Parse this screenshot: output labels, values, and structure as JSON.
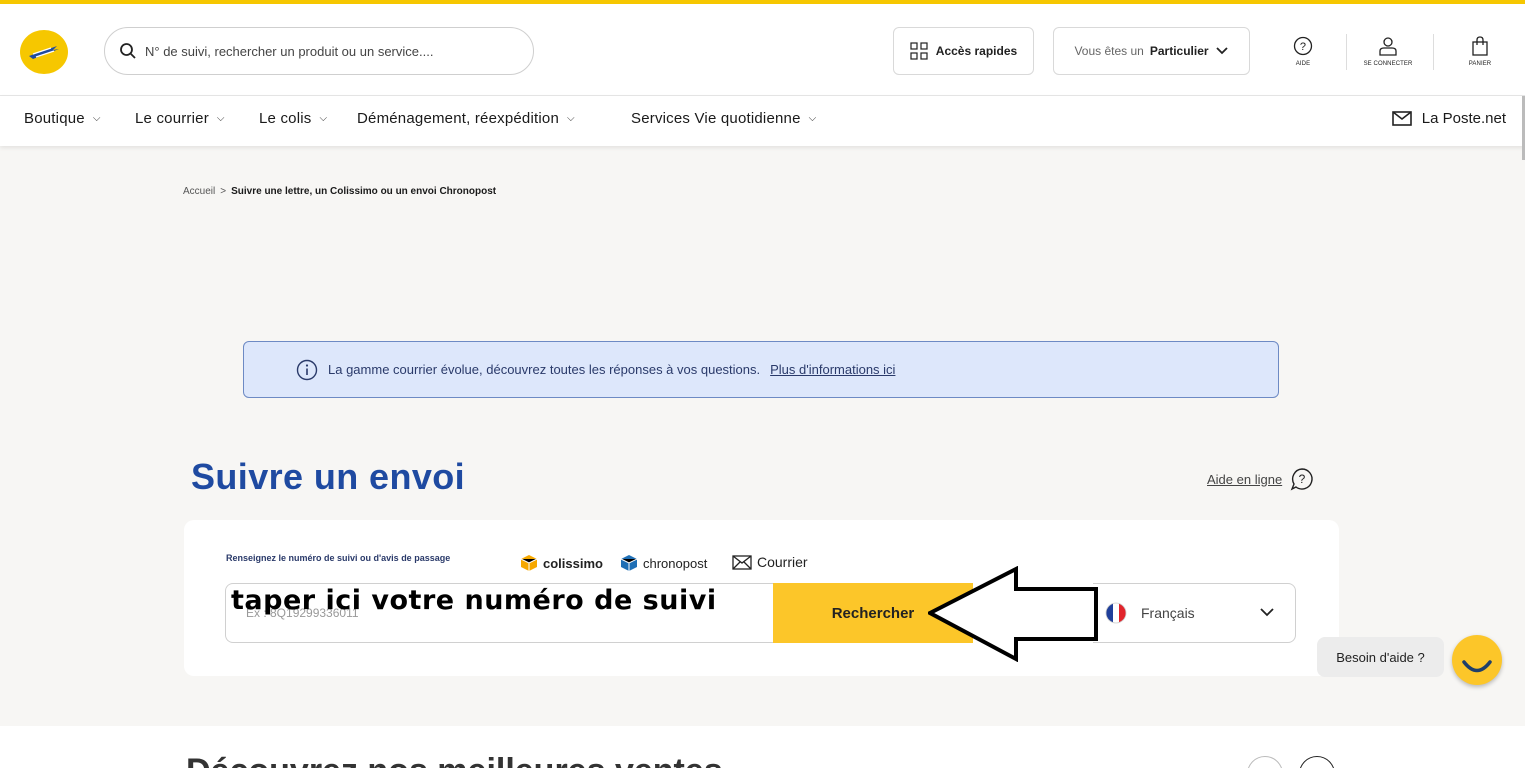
{
  "header": {
    "search_placeholder": "N° de suivi, rechercher un produit ou un service....",
    "acces_rapides": "Accès rapides",
    "profile_prefix": "Vous êtes un",
    "profile_value": "Particulier",
    "aide": "AIDE",
    "se_connecter": "SE CONNECTER",
    "panier": "PANIER"
  },
  "nav": {
    "items": [
      {
        "label": "Boutique"
      },
      {
        "label": "Le courrier"
      },
      {
        "label": "Le colis"
      },
      {
        "label": "Déménagement, réexpédition"
      },
      {
        "label": "Services Vie quotidienne"
      }
    ],
    "laposte_net": "La Poste.net"
  },
  "breadcrumb": {
    "home": "Accueil",
    "separator": ">",
    "current": "Suivre une lettre, un Colissimo ou un envoi Chronopost"
  },
  "banner": {
    "text": "La gamme courrier évolue, découvrez toutes les réponses à vos questions.",
    "link": "Plus d'informations ici"
  },
  "tracking": {
    "title": "Suivre un envoi",
    "aide_en_ligne": "Aide en ligne",
    "label": "Renseignez le numéro de suivi ou d'avis de passage",
    "brands": [
      "colissimo",
      "chronopost",
      "Courrier"
    ],
    "input_placeholder": "Ex : 8Q19299336011",
    "overlay_annotation": "taper ici votre numéro de suivi",
    "search_button": "Rechercher",
    "language": "Français"
  },
  "help": {
    "bubble": "Besoin d'aide ?"
  },
  "bottom": {
    "title": "Découvrez nos meilleures ventes"
  },
  "colors": {
    "accent_yellow": "#fcc629",
    "title_blue": "#1f4aa1",
    "banner_bg": "#dde7fb"
  }
}
